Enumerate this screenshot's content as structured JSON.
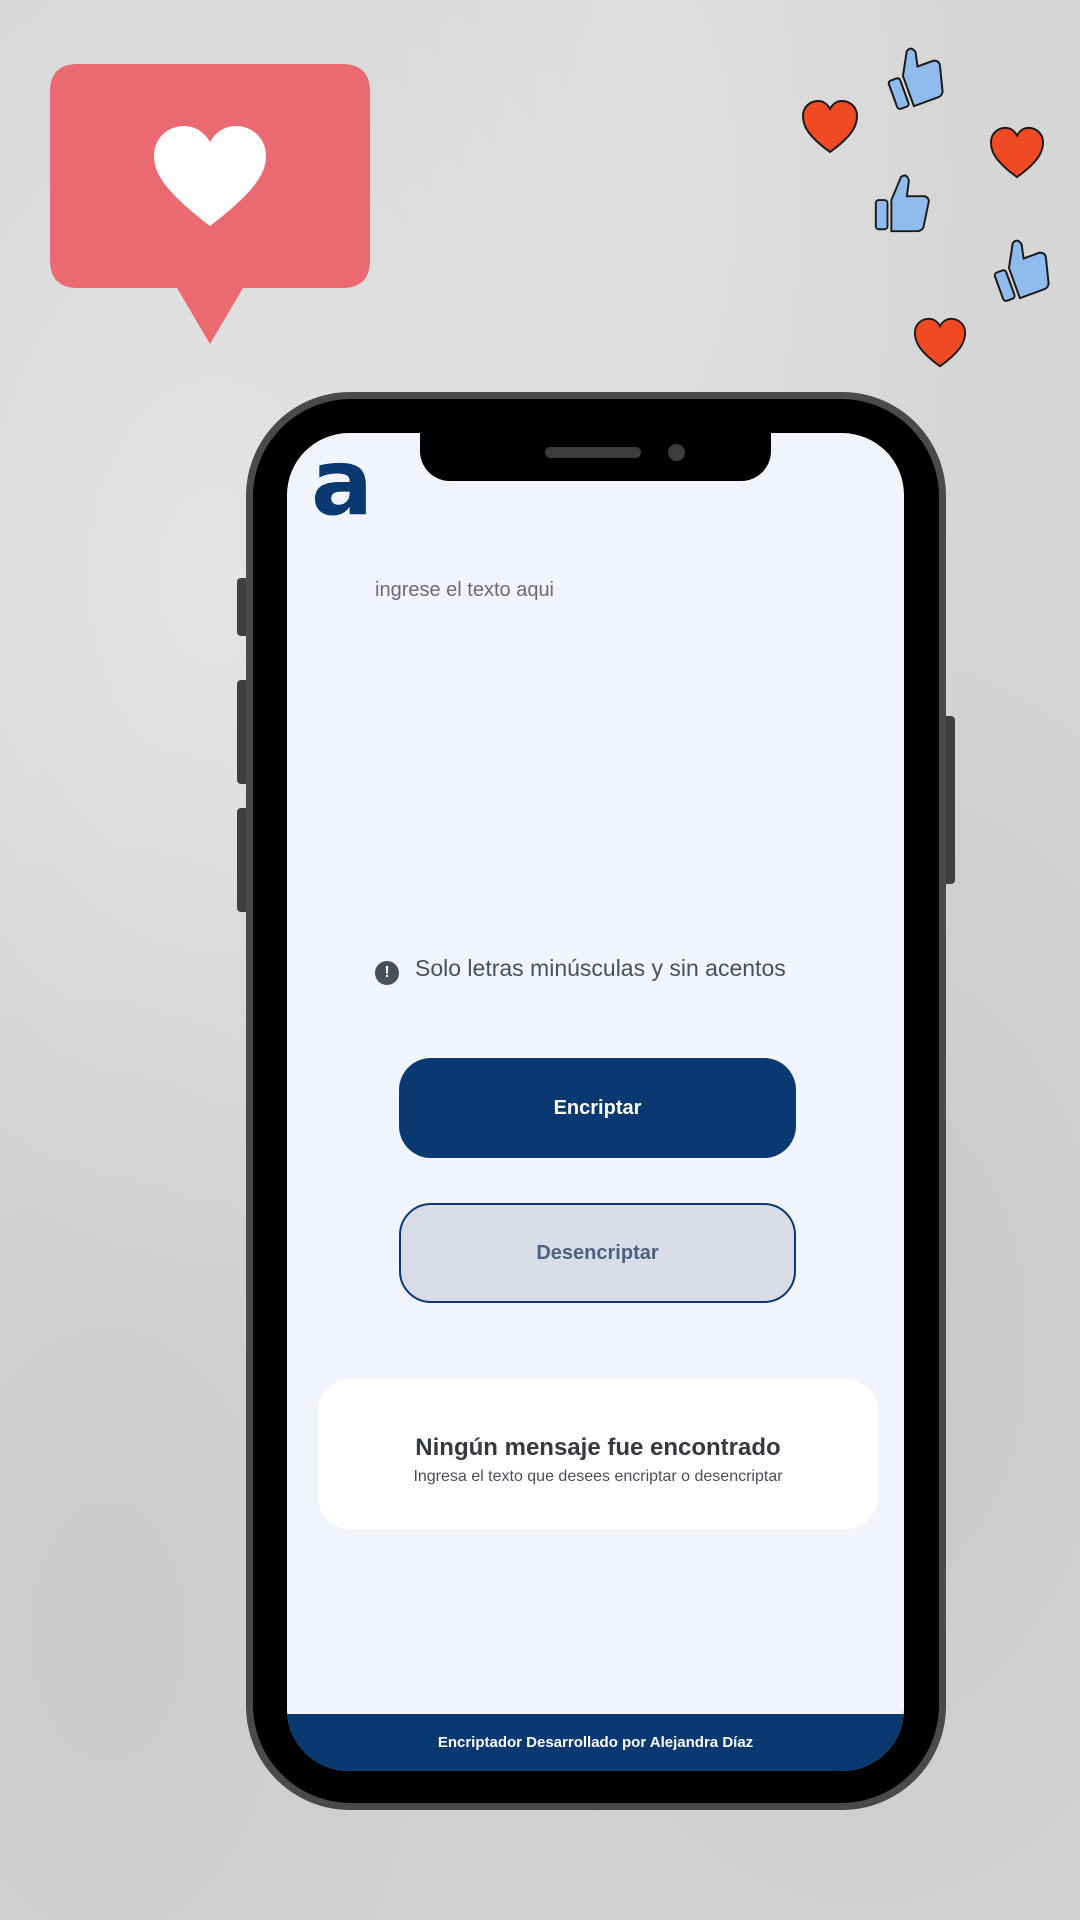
{
  "app": {
    "logo_letter": "a"
  },
  "input": {
    "placeholder": "ingrese el texto aqui",
    "value": ""
  },
  "hint": {
    "icon": "exclamation-icon",
    "text": "Solo letras minúsculas y sin acentos"
  },
  "buttons": {
    "encrypt_label": "Encriptar",
    "decrypt_label": "Desencriptar"
  },
  "result": {
    "title": "Ningún mensaje fue encontrado",
    "subtitle": "Ingresa el texto que desees encriptar o desencriptar"
  },
  "footer": {
    "text": "Encriptador Desarrollado por Alejandra Díaz"
  },
  "colors": {
    "primary": "#0a3871",
    "screen_background": "#f2f4fc",
    "secondary_button": "#d8dde8",
    "like_bubble": "#eb6a72",
    "heart_sticker": "#f04a24",
    "thumb_sticker": "#8fbcec"
  }
}
